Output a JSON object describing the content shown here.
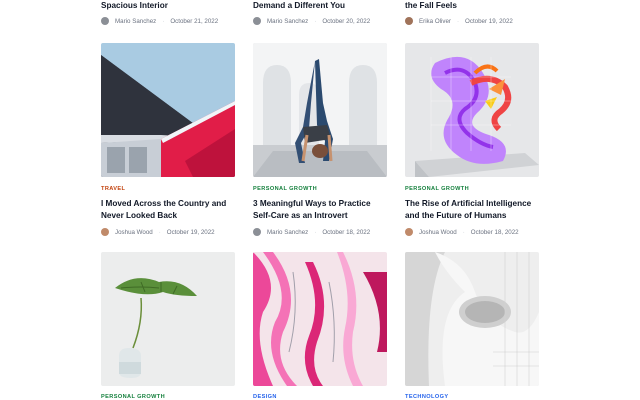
{
  "top_row": [
    {
      "title": "Spacious Interior",
      "author": "Mario Sanchez",
      "date": "October 21, 2022"
    },
    {
      "title": "Demand a Different You",
      "author": "Mario Sanchez",
      "date": "October 20, 2022"
    },
    {
      "title": "the Fall Feels",
      "author": "Erika Oliver",
      "date": "October 19, 2022"
    }
  ],
  "middle_row": [
    {
      "category": "Travel",
      "title": "I Moved Across the Country and Never Looked Back",
      "author": "Joshua Wood",
      "date": "October 19, 2022",
      "image": "architecture-red-facade"
    },
    {
      "category": "Personal Growth",
      "title": "3 Meaningful Ways to Practice Self-Care as an Introvert",
      "author": "Mario Sanchez",
      "date": "October 18, 2022",
      "image": "yoga-pose-arches"
    },
    {
      "category": "Personal Growth",
      "title": "The Rise of Artificial Intelligence and the Future of Humans",
      "author": "Joshua Wood",
      "date": "October 18, 2022",
      "image": "purple-3d-sculpture"
    }
  ],
  "bottom_row": [
    {
      "category": "Personal Growth",
      "image": "monstera-leaf-vase"
    },
    {
      "category": "Design",
      "image": "pink-fluid-art"
    },
    {
      "category": "Technology",
      "image": "white-curved-building"
    }
  ],
  "colors": {
    "travel": "#c2410c",
    "personal_growth": "#15803d",
    "design": "#2563eb",
    "technology": "#2563eb"
  }
}
